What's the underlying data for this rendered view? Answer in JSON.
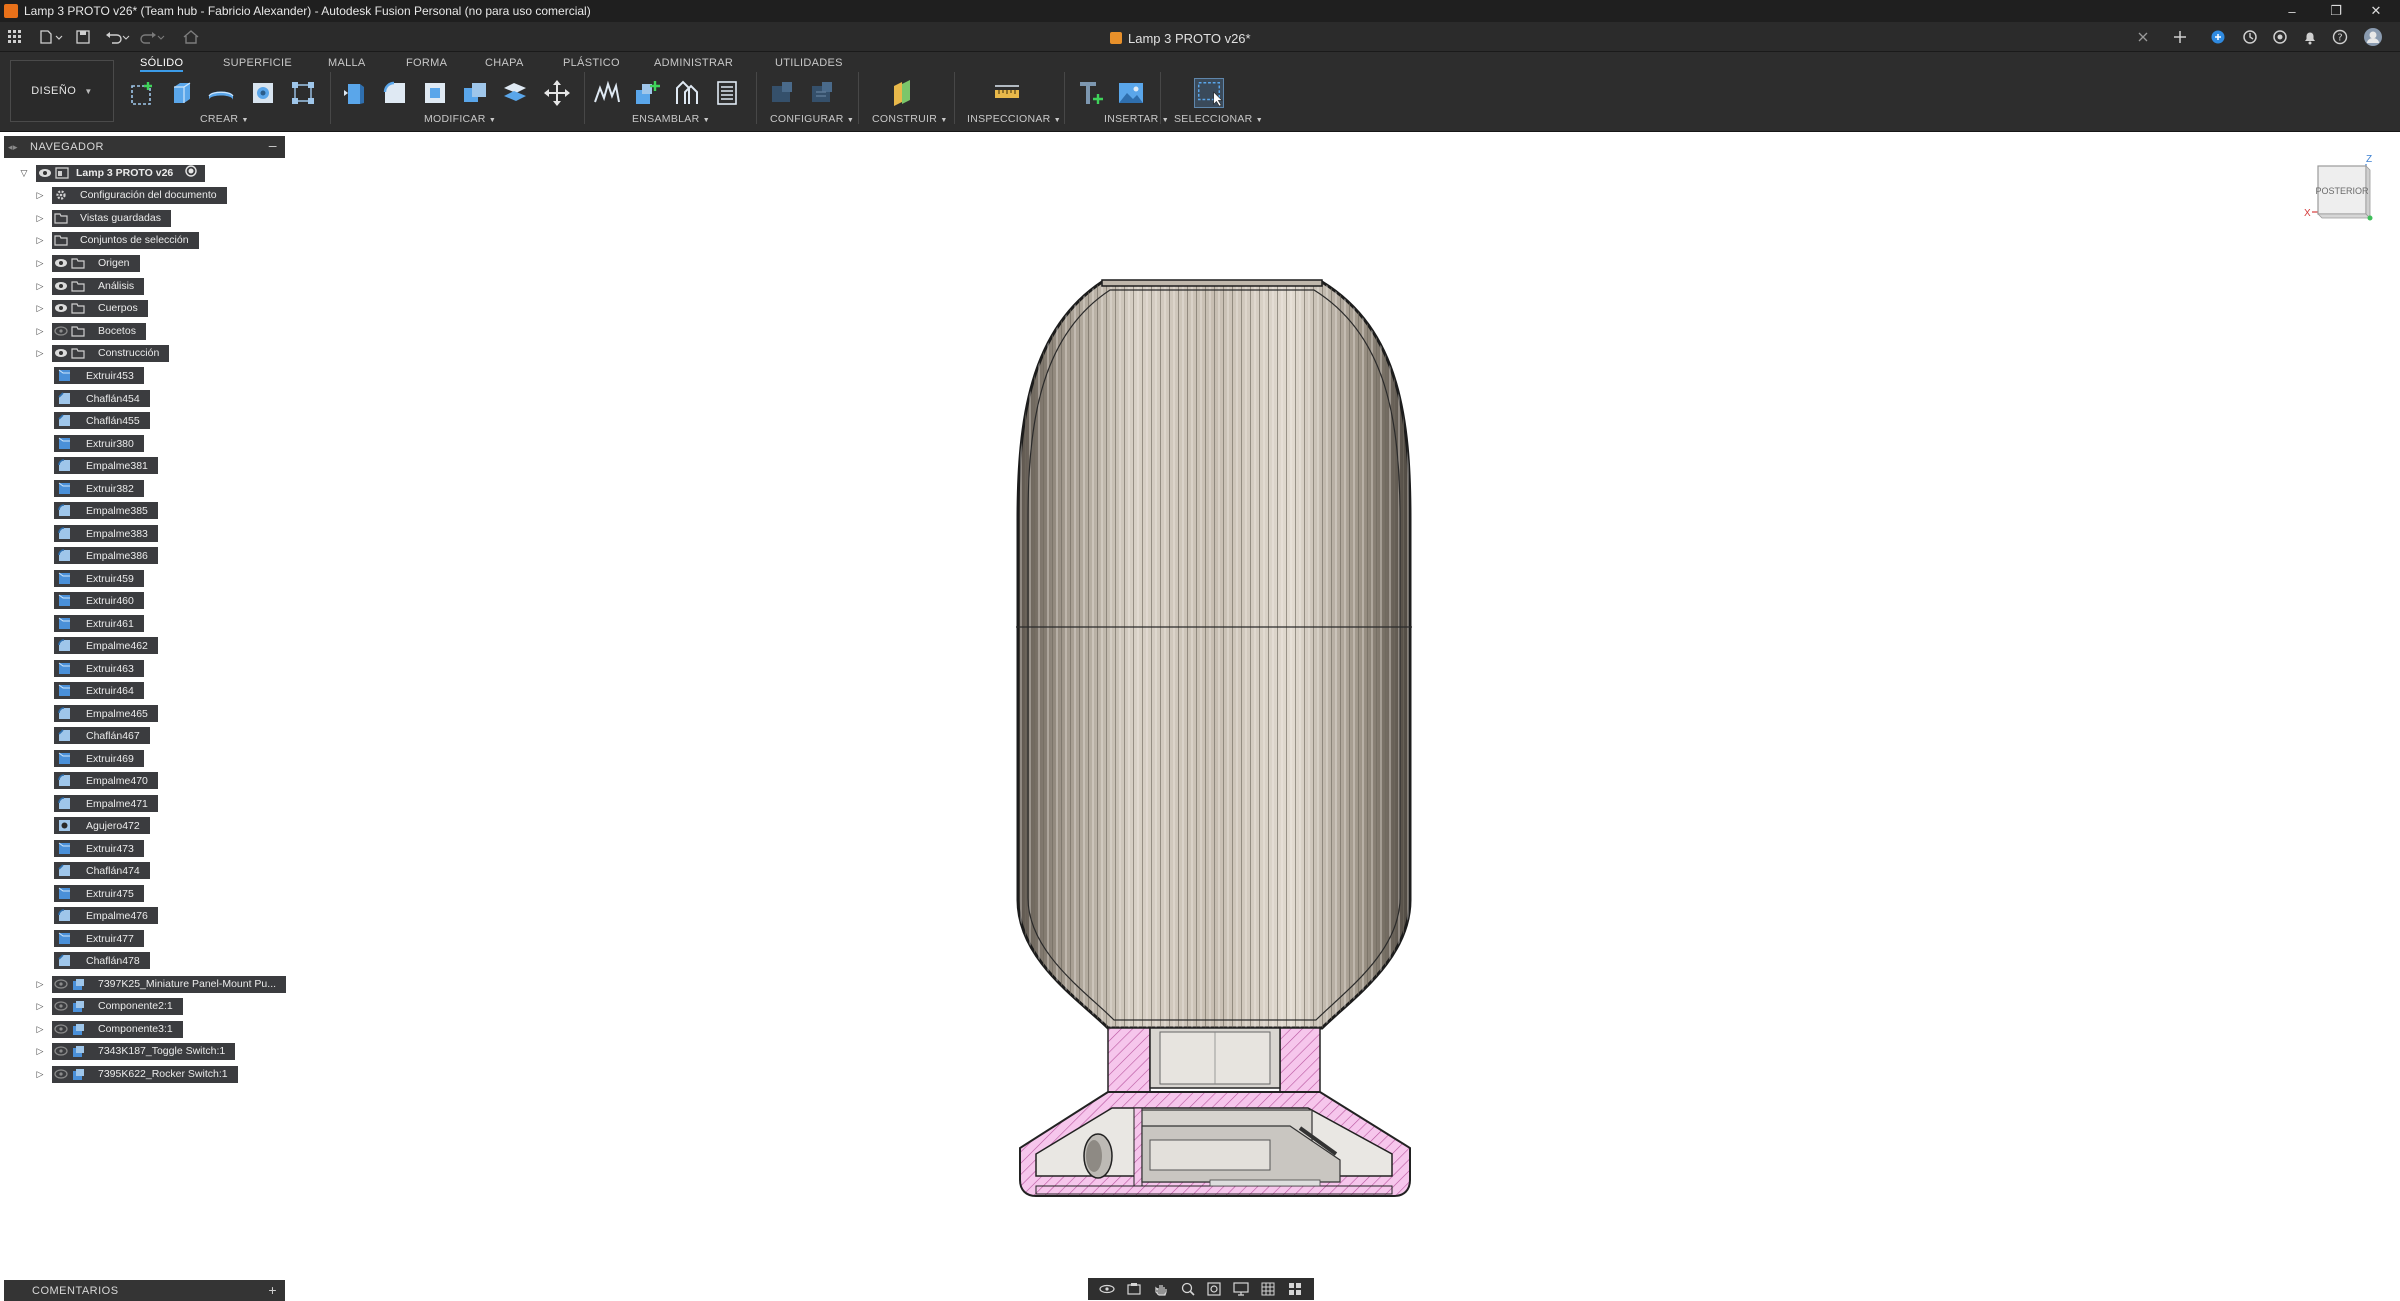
{
  "window": {
    "title": "Lamp 3 PROTO v26* (Team hub - Fabricio Alexander) - Autodesk Fusion Personal (no para uso comercial)",
    "document_tab": "Lamp 3 PROTO v26*",
    "minimize": "–",
    "restore": "❐",
    "close": "✕"
  },
  "toolbar": {
    "workspace": "DISEÑO",
    "tabs": [
      "SÓLIDO",
      "SUPERFICIE",
      "MALLA",
      "FORMA",
      "CHAPA",
      "PLÁSTICO",
      "ADMINISTRAR",
      "UTILIDADES"
    ],
    "groups": {
      "crear": "CREAR",
      "modificar": "MODIFICAR",
      "ensamblar": "ENSAMBLAR",
      "configurar": "CONFIGURAR",
      "construir": "CONSTRUIR",
      "inspeccionar": "INSPECCIONAR",
      "insertar": "INSERTAR",
      "seleccionar": "SELECCIONAR"
    }
  },
  "navigator": {
    "title": "NAVEGADOR",
    "root": "Lamp 3 PROTO v26",
    "folders": [
      "Configuración del documento",
      "Vistas guardadas",
      "Conjuntos de selección",
      "Origen",
      "Análisis",
      "Cuerpos",
      "Bocetos",
      "Construcción"
    ],
    "features": [
      "Extruir453",
      "Chaflán454",
      "Chaflán455",
      "Extruir380",
      "Empalme381",
      "Extruir382",
      "Empalme385",
      "Empalme383",
      "Empalme386",
      "Extruir459",
      "Extruir460",
      "Extruir461",
      "Empalme462",
      "Extruir463",
      "Extruir464",
      "Empalme465",
      "Chaflán467",
      "Extruir469",
      "Empalme470",
      "Empalme471",
      "Agujero472",
      "Extruir473",
      "Chaflán474",
      "Extruir475",
      "Empalme476",
      "Extruir477",
      "Chaflán478"
    ],
    "components": [
      "7397K25_Miniature Panel-Mount Pu...",
      "Componente2:1",
      "Componente3:1",
      "7343K187_Toggle Switch:1",
      "7395K622_Rocker Switch:1"
    ]
  },
  "comments": {
    "title": "COMENTARIOS"
  },
  "viewcube": {
    "face": "POSTERIOR",
    "axis_z": "Z",
    "axis_x": "X"
  },
  "colors": {
    "accent": "#3b9be8",
    "section_hatch": "#f2b6e6",
    "feature_icon": "#4a90d9"
  }
}
